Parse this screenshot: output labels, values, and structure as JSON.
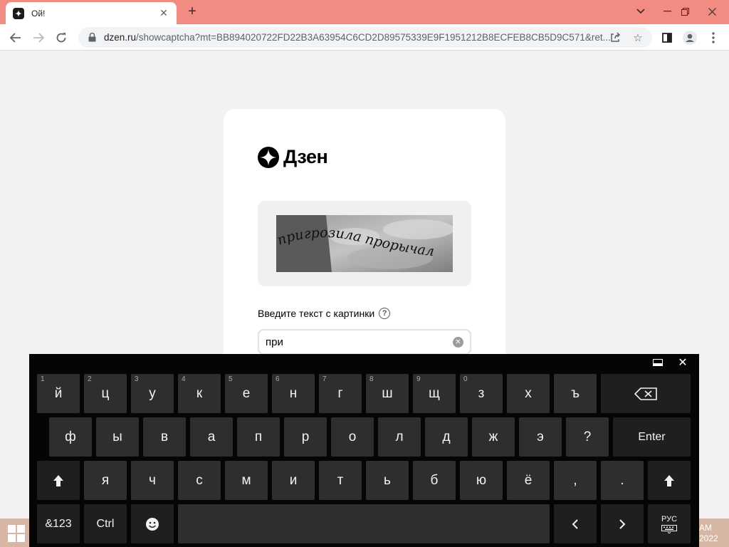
{
  "browser": {
    "tab_title": "Ой!",
    "url_domain": "dzen.ru",
    "url_path": "/showcaptcha?mt=BB894020722FD22B3A63954C6CD2D89575339E9F1951212B8ECFEB8CB5D9C571&ret...",
    "icons": [
      "back-icon",
      "forward-icon",
      "reload-icon",
      "lock-icon",
      "share-icon",
      "star-icon",
      "sidebar-icon",
      "profile-icon",
      "menu-icon"
    ]
  },
  "page": {
    "logo_text": "Дзен",
    "captcha_text": "пригрозила прорычал",
    "prompt_label": "Введите текст с картинки",
    "help_icon_glyph": "?",
    "input_value": "при"
  },
  "keyboard": {
    "rows": [
      [
        {
          "label": "й",
          "hint": "1"
        },
        {
          "label": "ц",
          "hint": "2"
        },
        {
          "label": "у",
          "hint": "3"
        },
        {
          "label": "к",
          "hint": "4"
        },
        {
          "label": "е",
          "hint": "5"
        },
        {
          "label": "н",
          "hint": "6"
        },
        {
          "label": "г",
          "hint": "7"
        },
        {
          "label": "ш",
          "hint": "8"
        },
        {
          "label": "щ",
          "hint": "9"
        },
        {
          "label": "з",
          "hint": "0"
        },
        {
          "label": "х",
          "hint": ""
        },
        {
          "label": "ъ",
          "hint": ""
        }
      ],
      [
        {
          "label": "ф"
        },
        {
          "label": "ы"
        },
        {
          "label": "в"
        },
        {
          "label": "а"
        },
        {
          "label": "п"
        },
        {
          "label": "р"
        },
        {
          "label": "о"
        },
        {
          "label": "л"
        },
        {
          "label": "д"
        },
        {
          "label": "ж"
        },
        {
          "label": "э"
        },
        {
          "label": "?"
        }
      ],
      [
        {
          "label": "я"
        },
        {
          "label": "ч"
        },
        {
          "label": "с"
        },
        {
          "label": "м"
        },
        {
          "label": "и"
        },
        {
          "label": "т"
        },
        {
          "label": "ь"
        },
        {
          "label": "б"
        },
        {
          "label": "ю"
        },
        {
          "label": "ё"
        },
        {
          "label": ","
        },
        {
          "label": "."
        }
      ]
    ],
    "enter_label": "Enter",
    "symbols_label": "&123",
    "ctrl_label": "Ctrl",
    "lang_label": "РУС"
  },
  "taskbar": {
    "clock_time": "AM",
    "clock_date": "2022"
  }
}
